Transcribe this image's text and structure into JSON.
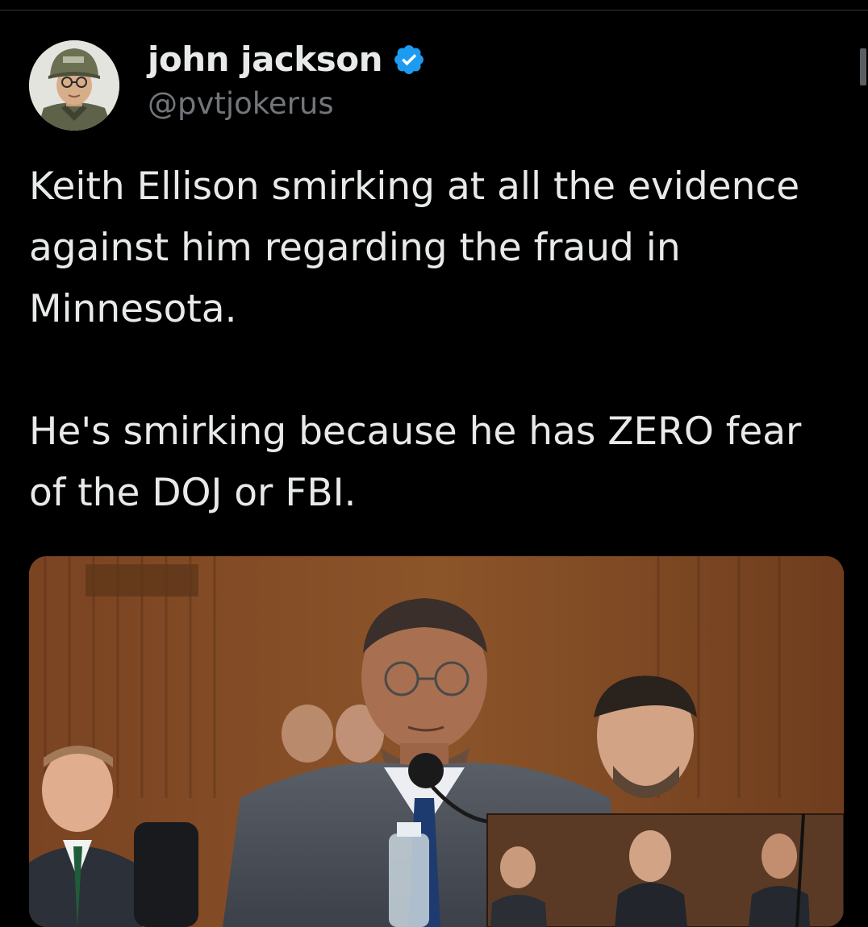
{
  "author": {
    "display_name": "john jackson",
    "handle": "@pvtjokerus",
    "verified": true,
    "avatar_icon": "soldier-helmet-avatar"
  },
  "tweet": {
    "paragraphs": [
      "Keith Ellison smirking at all the evidence against him regarding the fraud in Minnesota.",
      "He's smirking because he has ZERO fear of the DOJ or FBI."
    ]
  },
  "media": {
    "kind": "photo",
    "description_icon": "hearing-photo"
  },
  "colors": {
    "background": "#000000",
    "text": "#e7e9ea",
    "secondary_text": "#71767b",
    "verified_blue": "#1d9bf0"
  }
}
